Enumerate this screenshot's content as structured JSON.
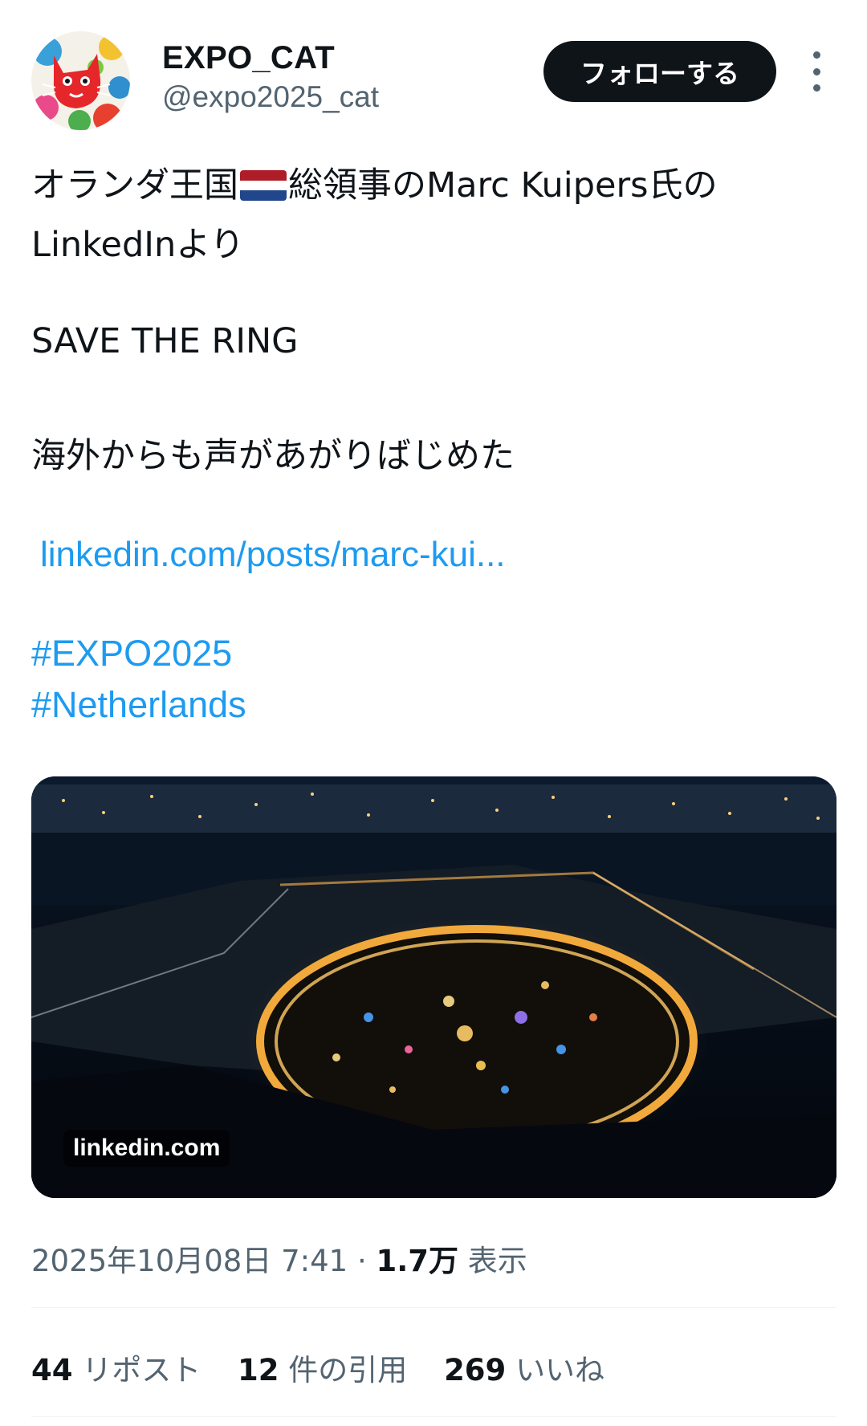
{
  "author": {
    "display_name": "EXPO_CAT",
    "handle": "@expo2025_cat",
    "follow_label": "フォローする"
  },
  "tweet": {
    "line1_before_flag": "オランダ王国",
    "flag": "Netherlands flag",
    "line1_after_flag": "総領事のMarc Kuipers氏の",
    "line2": "LinkedInより",
    "line3": "SAVE THE RING",
    "line4": "海外からも声があがりばじめた",
    "link_text": "linkedin.com/posts/marc-kui...",
    "hashtags": [
      "#EXPO2025",
      "#Netherlands"
    ]
  },
  "card": {
    "domain": "linkedin.com"
  },
  "meta": {
    "timestamp": "2025年10月08日 7:41",
    "separator": "·",
    "views_count": "1.7万",
    "views_label": "表示"
  },
  "stats": {
    "reposts_count": "44",
    "reposts_label": "リポスト",
    "quotes_count": "12",
    "quotes_label": "件の引用",
    "likes_count": "269",
    "likes_label": "いいね"
  },
  "colors": {
    "accent_link": "#1d9bf0",
    "text_primary": "#0f1419",
    "text_secondary": "#536471",
    "follow_bg": "#0f1419"
  }
}
